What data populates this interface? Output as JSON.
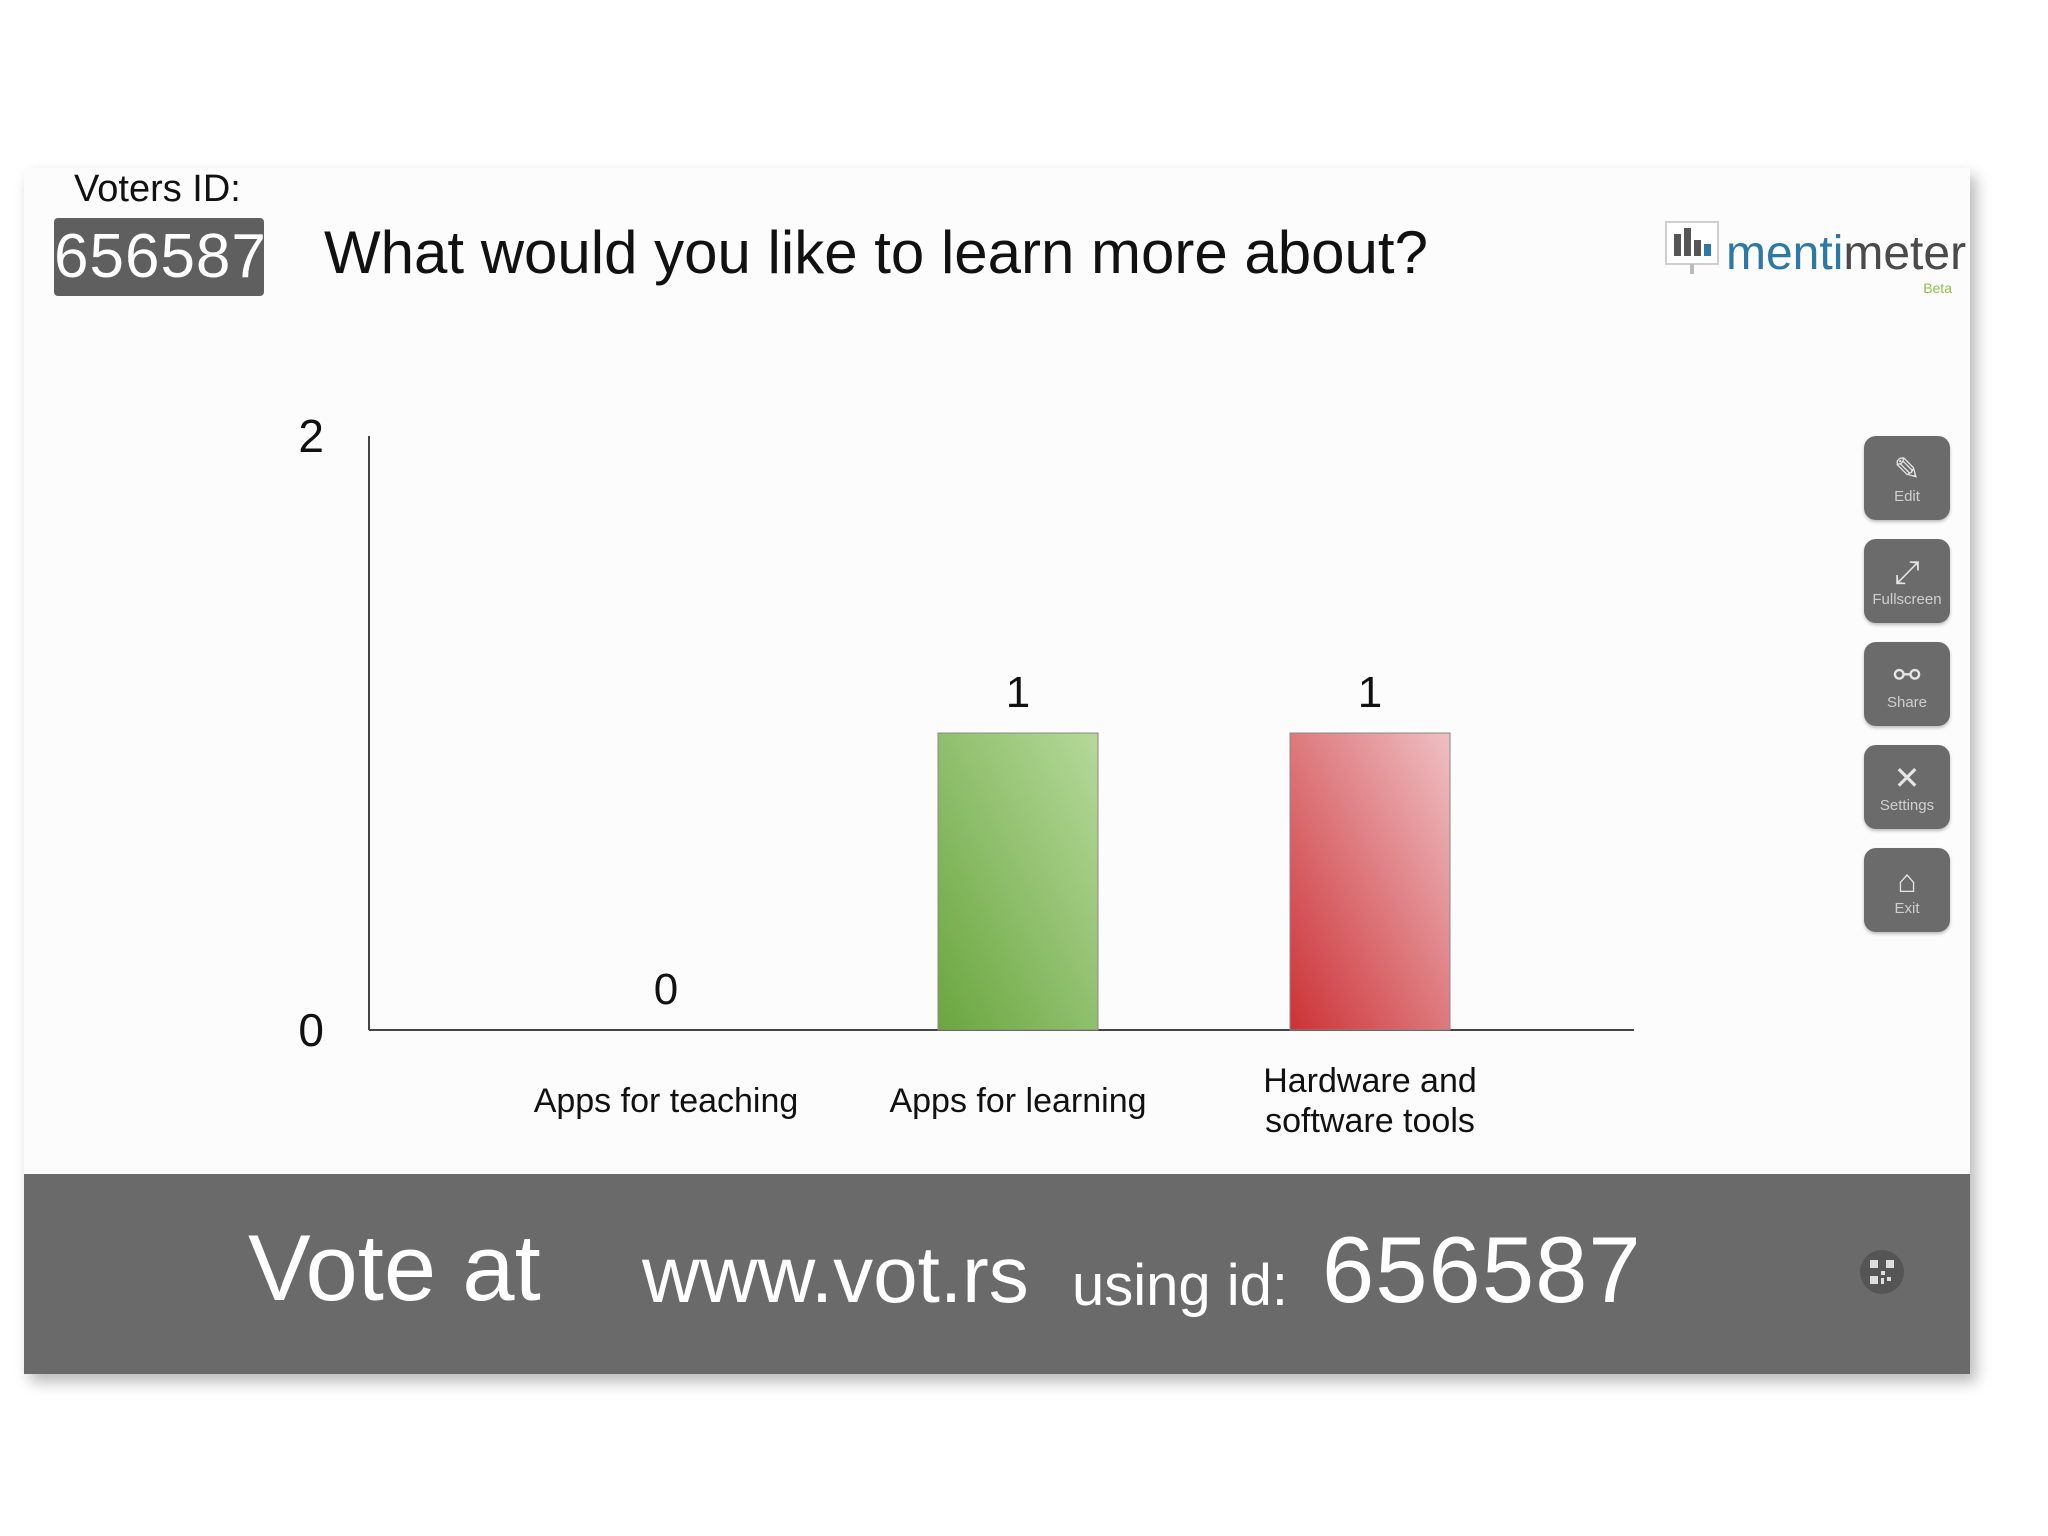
{
  "header": {
    "voters_label": "Voters ID:",
    "voters_id": "656587",
    "question": "What would you like to learn more about?"
  },
  "logo": {
    "text_part1": "menti",
    "text_part2": "meter",
    "beta": "Beta"
  },
  "chart_data": {
    "type": "bar",
    "title": "What would you like to learn more about?",
    "categories": [
      "Apps for teaching",
      "Apps for learning",
      "Hardware and software tools"
    ],
    "category_lines": [
      [
        "Apps for teaching"
      ],
      [
        "Apps for learning"
      ],
      [
        "Hardware and",
        "software tools"
      ]
    ],
    "values": [
      0,
      1,
      1
    ],
    "ylim": [
      0,
      2
    ],
    "yticks": [
      0,
      2
    ],
    "colors": [
      "#8fc97a",
      "#7db65a",
      "#d4454a"
    ],
    "grid": false,
    "legend": "none"
  },
  "tools": [
    {
      "label": "Edit",
      "icon": "edit-icon",
      "glyph": "✎"
    },
    {
      "label": "Fullscreen",
      "icon": "fullscreen-icon",
      "glyph": "⤢"
    },
    {
      "label": "Share",
      "icon": "share-icon",
      "glyph": "⚯"
    },
    {
      "label": "Settings",
      "icon": "settings-icon",
      "glyph": "✕"
    },
    {
      "label": "Exit",
      "icon": "home-icon",
      "glyph": "⌂"
    }
  ],
  "footer": {
    "vote_at": "Vote at",
    "url": "www.vot.rs",
    "using_id": "using id:",
    "id": "656587",
    "qr_icon": "qr-code-icon"
  },
  "colors": {
    "bar_bg": "#6a6a6a",
    "menti_blue": "#2b79a4"
  }
}
